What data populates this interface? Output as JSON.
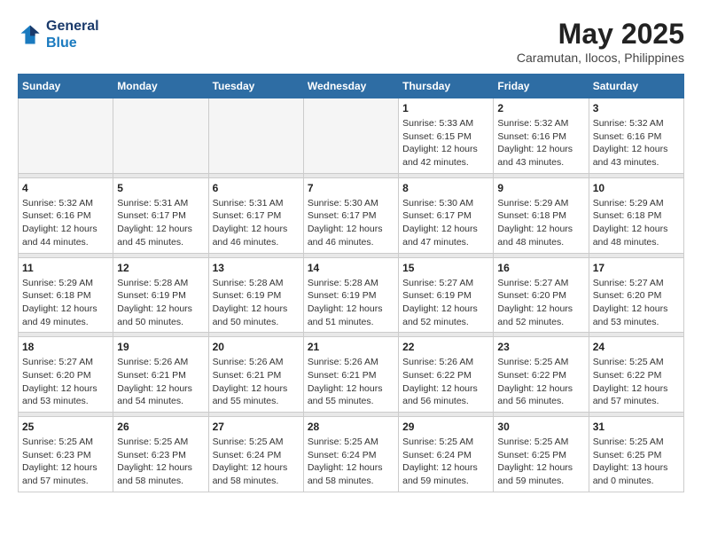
{
  "header": {
    "logo_line1": "General",
    "logo_line2": "Blue",
    "month_year": "May 2025",
    "location": "Caramutan, Ilocos, Philippines"
  },
  "weekdays": [
    "Sunday",
    "Monday",
    "Tuesday",
    "Wednesday",
    "Thursday",
    "Friday",
    "Saturday"
  ],
  "weeks": [
    [
      {
        "day": "",
        "empty": true
      },
      {
        "day": "",
        "empty": true
      },
      {
        "day": "",
        "empty": true
      },
      {
        "day": "",
        "empty": true
      },
      {
        "day": "1",
        "sunrise": "5:33 AM",
        "sunset": "6:15 PM",
        "daylight": "12 hours and 42 minutes."
      },
      {
        "day": "2",
        "sunrise": "5:32 AM",
        "sunset": "6:16 PM",
        "daylight": "12 hours and 43 minutes."
      },
      {
        "day": "3",
        "sunrise": "5:32 AM",
        "sunset": "6:16 PM",
        "daylight": "12 hours and 43 minutes."
      }
    ],
    [
      {
        "day": "4",
        "sunrise": "5:32 AM",
        "sunset": "6:16 PM",
        "daylight": "12 hours and 44 minutes."
      },
      {
        "day": "5",
        "sunrise": "5:31 AM",
        "sunset": "6:17 PM",
        "daylight": "12 hours and 45 minutes."
      },
      {
        "day": "6",
        "sunrise": "5:31 AM",
        "sunset": "6:17 PM",
        "daylight": "12 hours and 46 minutes."
      },
      {
        "day": "7",
        "sunrise": "5:30 AM",
        "sunset": "6:17 PM",
        "daylight": "12 hours and 46 minutes."
      },
      {
        "day": "8",
        "sunrise": "5:30 AM",
        "sunset": "6:17 PM",
        "daylight": "12 hours and 47 minutes."
      },
      {
        "day": "9",
        "sunrise": "5:29 AM",
        "sunset": "6:18 PM",
        "daylight": "12 hours and 48 minutes."
      },
      {
        "day": "10",
        "sunrise": "5:29 AM",
        "sunset": "6:18 PM",
        "daylight": "12 hours and 48 minutes."
      }
    ],
    [
      {
        "day": "11",
        "sunrise": "5:29 AM",
        "sunset": "6:18 PM",
        "daylight": "12 hours and 49 minutes."
      },
      {
        "day": "12",
        "sunrise": "5:28 AM",
        "sunset": "6:19 PM",
        "daylight": "12 hours and 50 minutes."
      },
      {
        "day": "13",
        "sunrise": "5:28 AM",
        "sunset": "6:19 PM",
        "daylight": "12 hours and 50 minutes."
      },
      {
        "day": "14",
        "sunrise": "5:28 AM",
        "sunset": "6:19 PM",
        "daylight": "12 hours and 51 minutes."
      },
      {
        "day": "15",
        "sunrise": "5:27 AM",
        "sunset": "6:19 PM",
        "daylight": "12 hours and 52 minutes."
      },
      {
        "day": "16",
        "sunrise": "5:27 AM",
        "sunset": "6:20 PM",
        "daylight": "12 hours and 52 minutes."
      },
      {
        "day": "17",
        "sunrise": "5:27 AM",
        "sunset": "6:20 PM",
        "daylight": "12 hours and 53 minutes."
      }
    ],
    [
      {
        "day": "18",
        "sunrise": "5:27 AM",
        "sunset": "6:20 PM",
        "daylight": "12 hours and 53 minutes."
      },
      {
        "day": "19",
        "sunrise": "5:26 AM",
        "sunset": "6:21 PM",
        "daylight": "12 hours and 54 minutes."
      },
      {
        "day": "20",
        "sunrise": "5:26 AM",
        "sunset": "6:21 PM",
        "daylight": "12 hours and 55 minutes."
      },
      {
        "day": "21",
        "sunrise": "5:26 AM",
        "sunset": "6:21 PM",
        "daylight": "12 hours and 55 minutes."
      },
      {
        "day": "22",
        "sunrise": "5:26 AM",
        "sunset": "6:22 PM",
        "daylight": "12 hours and 56 minutes."
      },
      {
        "day": "23",
        "sunrise": "5:25 AM",
        "sunset": "6:22 PM",
        "daylight": "12 hours and 56 minutes."
      },
      {
        "day": "24",
        "sunrise": "5:25 AM",
        "sunset": "6:22 PM",
        "daylight": "12 hours and 57 minutes."
      }
    ],
    [
      {
        "day": "25",
        "sunrise": "5:25 AM",
        "sunset": "6:23 PM",
        "daylight": "12 hours and 57 minutes."
      },
      {
        "day": "26",
        "sunrise": "5:25 AM",
        "sunset": "6:23 PM",
        "daylight": "12 hours and 58 minutes."
      },
      {
        "day": "27",
        "sunrise": "5:25 AM",
        "sunset": "6:24 PM",
        "daylight": "12 hours and 58 minutes."
      },
      {
        "day": "28",
        "sunrise": "5:25 AM",
        "sunset": "6:24 PM",
        "daylight": "12 hours and 58 minutes."
      },
      {
        "day": "29",
        "sunrise": "5:25 AM",
        "sunset": "6:24 PM",
        "daylight": "12 hours and 59 minutes."
      },
      {
        "day": "30",
        "sunrise": "5:25 AM",
        "sunset": "6:25 PM",
        "daylight": "12 hours and 59 minutes."
      },
      {
        "day": "31",
        "sunrise": "5:25 AM",
        "sunset": "6:25 PM",
        "daylight": "13 hours and 0 minutes."
      }
    ]
  ]
}
